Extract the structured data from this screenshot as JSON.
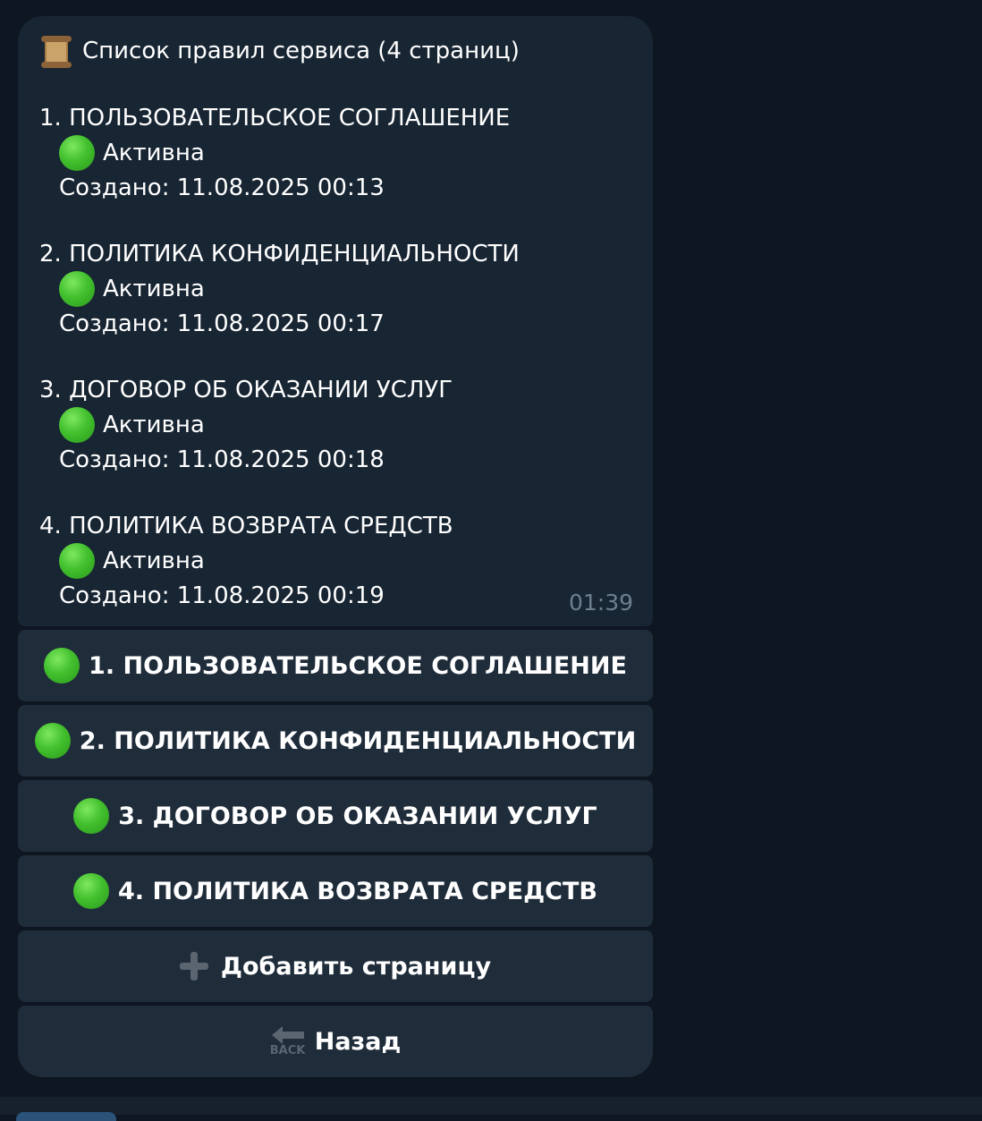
{
  "message": {
    "title": "Список правил сервиса (4 страниц)",
    "title_icon": "scroll-icon",
    "entries": [
      {
        "name": "1. ПОЛЬЗОВАТЕЛЬСКОЕ СОГЛАШЕНИЕ",
        "status": "Активна",
        "created": "Создано: 11.08.2025 00:13"
      },
      {
        "name": "2. ПОЛИТИКА КОНФИДЕНЦИАЛЬНОСТИ",
        "status": "Активна",
        "created": "Создано: 11.08.2025 00:17"
      },
      {
        "name": "3. ДОГОВОР ОБ ОКАЗАНИИ УСЛУГ",
        "status": "Активна",
        "created": "Создано: 11.08.2025 00:18"
      },
      {
        "name": "4. ПОЛИТИКА ВОЗВРАТА СРЕДСТВ",
        "status": "Активна",
        "created": "Создано: 11.08.2025 00:19"
      }
    ],
    "time": "01:39"
  },
  "keyboard": {
    "pages": [
      {
        "label": "1. ПОЛЬЗОВАТЕЛЬСКОЕ СОГЛАШЕНИЕ",
        "icon": "green-circle-icon"
      },
      {
        "label": "2. ПОЛИТИКА КОНФИДЕНЦИАЛЬНОСТИ",
        "icon": "green-circle-icon"
      },
      {
        "label": "3. ДОГОВОР ОБ ОКАЗАНИИ УСЛУГ",
        "icon": "green-circle-icon"
      },
      {
        "label": "4. ПОЛИТИКА ВОЗВРАТА СРЕДСТВ",
        "icon": "green-circle-icon"
      }
    ],
    "add_page": {
      "label": "Добавить страницу",
      "icon": "plus-icon"
    },
    "back": {
      "label": "Назад",
      "icon": "back-arrow-icon",
      "icon_text": "BACK"
    }
  },
  "colors": {
    "background": "#0e1621",
    "bubble": "#182533",
    "button": "#1f2c3a",
    "status_green": "#43c02e",
    "timestamp": "#6d7f8f"
  }
}
